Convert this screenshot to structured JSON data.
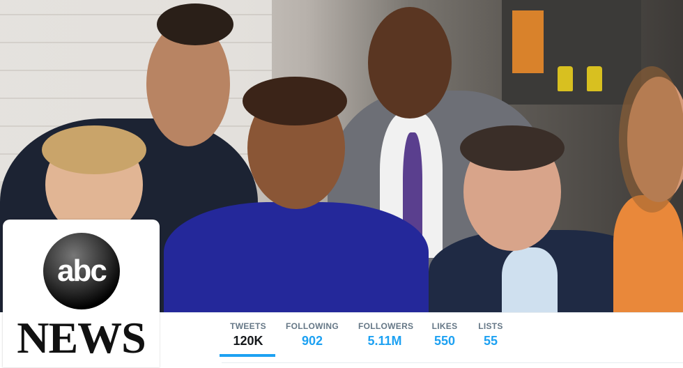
{
  "header": {
    "photo_alt": "cover-photo",
    "accent_color": "#1da1f2"
  },
  "profile": {
    "logo_top": "abc",
    "logo_bottom": "NEWS"
  },
  "stats": [
    {
      "label": "TWEETS",
      "value": "120K",
      "active": true
    },
    {
      "label": "FOLLOWING",
      "value": "902"
    },
    {
      "label": "FOLLOWERS",
      "value": "5.11M"
    },
    {
      "label": "LIKES",
      "value": "550"
    },
    {
      "label": "LISTS",
      "value": "55"
    }
  ]
}
